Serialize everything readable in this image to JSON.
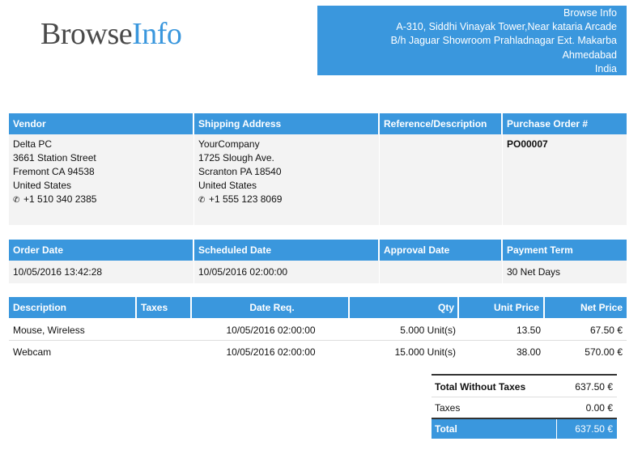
{
  "brand": {
    "part1": "Browse",
    "part2": "Info"
  },
  "company": {
    "name": "Browse Info",
    "line1": "A-310, Siddhi Vinayak Tower,Near kataria Arcade",
    "line2": "B/h Jaguar Showroom Prahladnagar Ext. Makarba",
    "city": "Ahmedabad",
    "country": "India"
  },
  "top_headers": [
    "Vendor",
    "Shipping Address",
    "Reference/Description",
    "Purchase Order #"
  ],
  "vendor": [
    "Delta PC",
    "3661 Station Street",
    "Fremont CA 94538",
    "United States"
  ],
  "vendor_phone": "+1 510 340 2385",
  "shipping": [
    "YourCompany",
    "1725 Slough Ave.",
    "Scranton PA 18540",
    "United States"
  ],
  "shipping_phone": "+1 555 123 8069",
  "reference": "",
  "po_number": "PO00007",
  "date_headers": [
    "Order Date",
    "Scheduled Date",
    "Approval Date",
    "Payment Term"
  ],
  "dates": {
    "order": "10/05/2016 13:42:28",
    "scheduled": "10/05/2016 02:00:00",
    "approval": "",
    "payment_term": "30 Net Days"
  },
  "line_headers": {
    "description": "Description",
    "taxes": "Taxes",
    "date_req": "Date Req.",
    "qty": "Qty",
    "unit_price": "Unit Price",
    "net_price": "Net Price"
  },
  "lines": [
    {
      "description": "Mouse, Wireless",
      "taxes": "",
      "date_req": "10/05/2016 02:00:00",
      "qty": "5.000 Unit(s)",
      "unit_price": "13.50",
      "net_price": "67.50 €"
    },
    {
      "description": "Webcam",
      "taxes": "",
      "date_req": "10/05/2016 02:00:00",
      "qty": "15.000 Unit(s)",
      "unit_price": "38.00",
      "net_price": "570.00 €"
    }
  ],
  "totals": {
    "without_taxes_label": "Total Without Taxes",
    "without_taxes": "637.50 €",
    "taxes_label": "Taxes",
    "taxes": "0.00 €",
    "total_label": "Total",
    "total": "637.50 €"
  },
  "colors": {
    "accent": "#3a97dd",
    "panel": "#f3f3f3"
  },
  "icons": {
    "phone": "phone-icon"
  }
}
